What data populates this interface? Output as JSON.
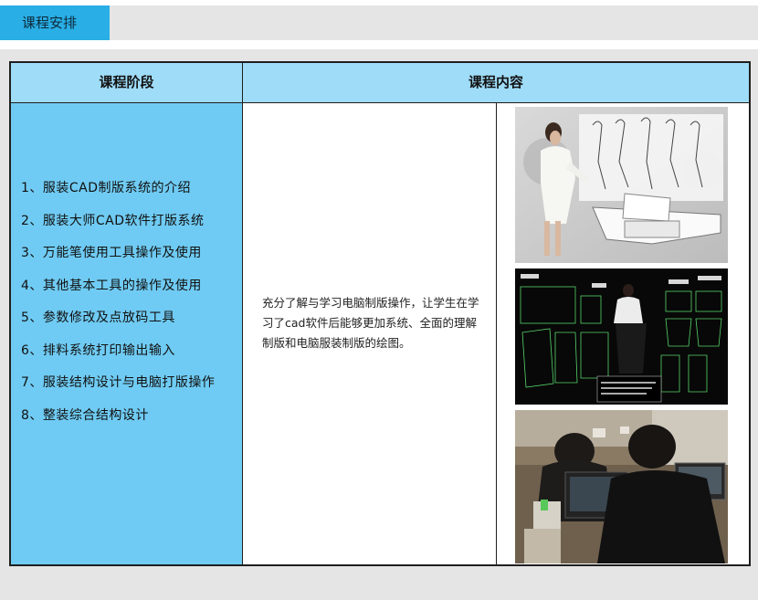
{
  "header": {
    "title": "课程安排"
  },
  "table": {
    "columns": [
      "课程阶段",
      "课程内容"
    ],
    "stages": [
      "1、服装CAD制版系统的介绍",
      "2、服装大师CAD软件打版系统",
      "3、万能笔使用工具操作及使用",
      "4、其他基本工具的操作及使用",
      "5、参数修改及点放码工具",
      "6、排料系统打印输出输入",
      "7、服装结构设计与电脑打版操作",
      "8、整装综合结构设计"
    ],
    "content": "充分了解与学习电脑制版操作，让学生在学习了cad软件后能够更加系统、全面的理解制版和电脑服装制版的绘图。"
  },
  "colors": {
    "tab": "#29aee5",
    "header_row": "#9fdcf8",
    "stage_col": "#6fcbf3",
    "panel_bg": "#e5e5e5"
  }
}
